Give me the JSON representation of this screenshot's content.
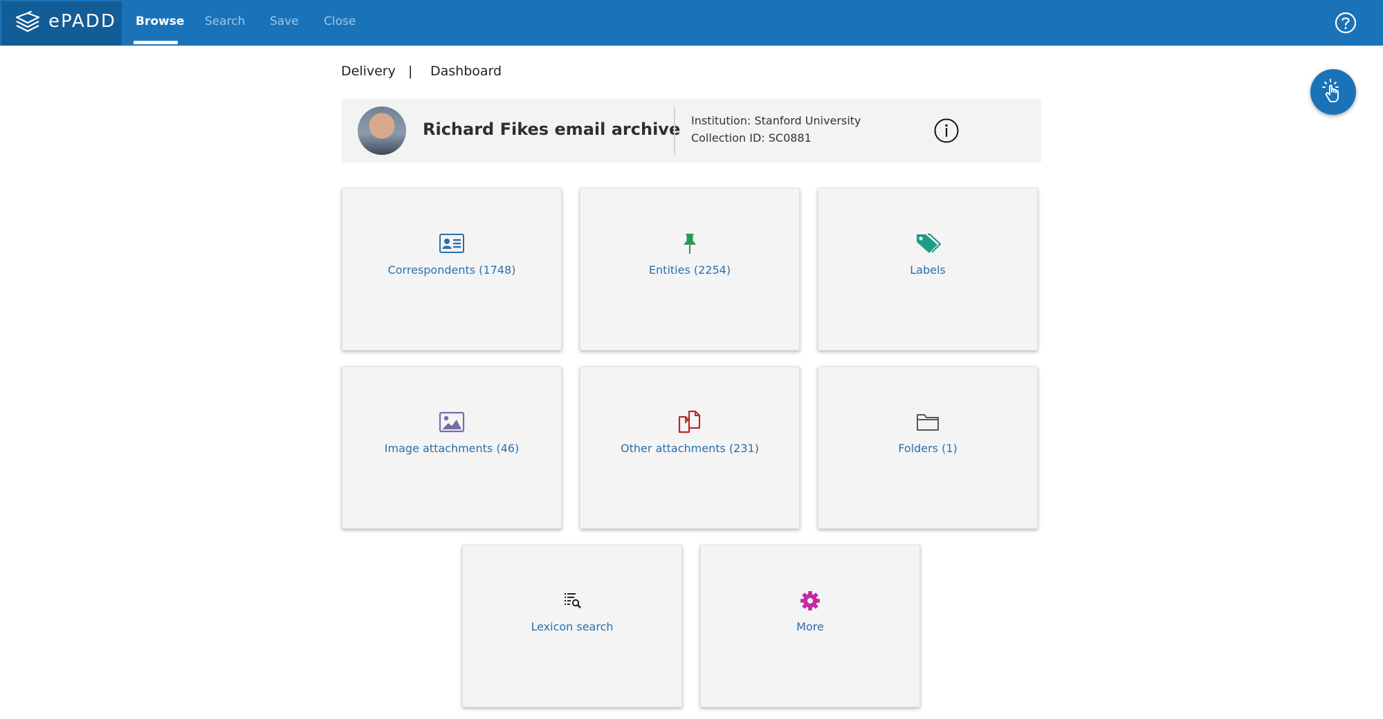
{
  "app": {
    "logo_text": "ePADD",
    "nav": [
      {
        "label": "Browse",
        "active": true
      },
      {
        "label": "Search",
        "active": false
      },
      {
        "label": "Save",
        "active": false
      },
      {
        "label": "Close",
        "active": false
      }
    ],
    "help_icon": "help-icon",
    "brand_color": "#1a73b8"
  },
  "breadcrumb": {
    "module": "Delivery",
    "separator": "|",
    "page": "Dashboard"
  },
  "archive": {
    "title": "Richard Fikes email archive",
    "institution": "Institution: Stanford University",
    "collection_id": "Collection ID: SC0881",
    "info_icon": "info-icon"
  },
  "tiles": [
    {
      "label": "Correspondents (1748)",
      "icon": "contact-card-icon",
      "color": "#2b6fa8"
    },
    {
      "label": "Entities (2254)",
      "icon": "pushpin-icon",
      "color": "#2e9a4b"
    },
    {
      "label": "Labels",
      "icon": "tags-icon",
      "color": "#1f9b8a"
    },
    {
      "label": "Image attachments (46)",
      "icon": "image-icon",
      "color": "#7a6aa8"
    },
    {
      "label": "Other attachments (231)",
      "icon": "copy-documents-icon",
      "color": "#b52a2a"
    },
    {
      "label": "Folders (1)",
      "icon": "folder-icon",
      "color": "#555555"
    },
    {
      "label": "Lexicon search",
      "icon": "lexicon-search-icon",
      "color": "#222222"
    },
    {
      "label": "More",
      "icon": "gear-icon",
      "color": "#c52aa6"
    }
  ],
  "fab_icon": "tap-gesture-icon"
}
